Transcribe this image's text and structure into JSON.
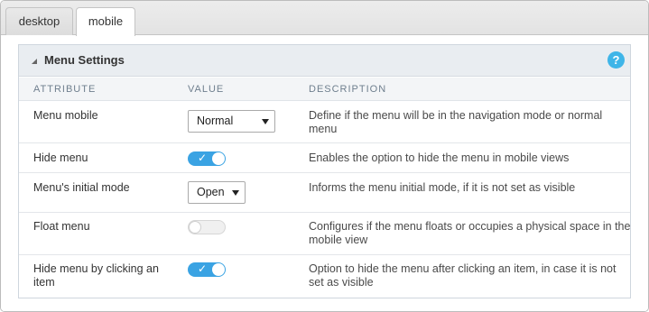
{
  "tabs": [
    {
      "label": "desktop",
      "active": false
    },
    {
      "label": "mobile",
      "active": true
    }
  ],
  "panel": {
    "title": "Menu Settings",
    "help_symbol": "?"
  },
  "columns": {
    "attribute": "ATTRIBUTE",
    "value": "VALUE",
    "description": "DESCRIPTION"
  },
  "rows": [
    {
      "attribute": "Menu mobile",
      "control": "select",
      "selected": "Normal",
      "description": "Define if the menu will be in the navigation mode or normal menu"
    },
    {
      "attribute": "Hide menu",
      "control": "toggle",
      "checked": true,
      "description": "Enables the option to hide the menu in mobile views"
    },
    {
      "attribute": "Menu's initial mode",
      "control": "select",
      "selected": "Open",
      "description": "Informs the menu initial mode, if it is not set as visible"
    },
    {
      "attribute": "Float menu",
      "control": "toggle",
      "checked": false,
      "description": "Configures if the menu floats or occupies a physical space in the mobile view"
    },
    {
      "attribute": "Hide menu by clicking an item",
      "control": "toggle",
      "checked": true,
      "description": "Option to hide the menu after clicking an item, in case it is not set as visible"
    }
  ],
  "icons": {
    "check": "✓",
    "collapse": "collapse-arrow-icon",
    "help": "help-icon",
    "caret": "chevron-down-icon"
  },
  "colors": {
    "toggle_on": "#3aa3e3",
    "help_icon": "#3fb5e8",
    "panel_header_bg": "#e9edf1"
  }
}
